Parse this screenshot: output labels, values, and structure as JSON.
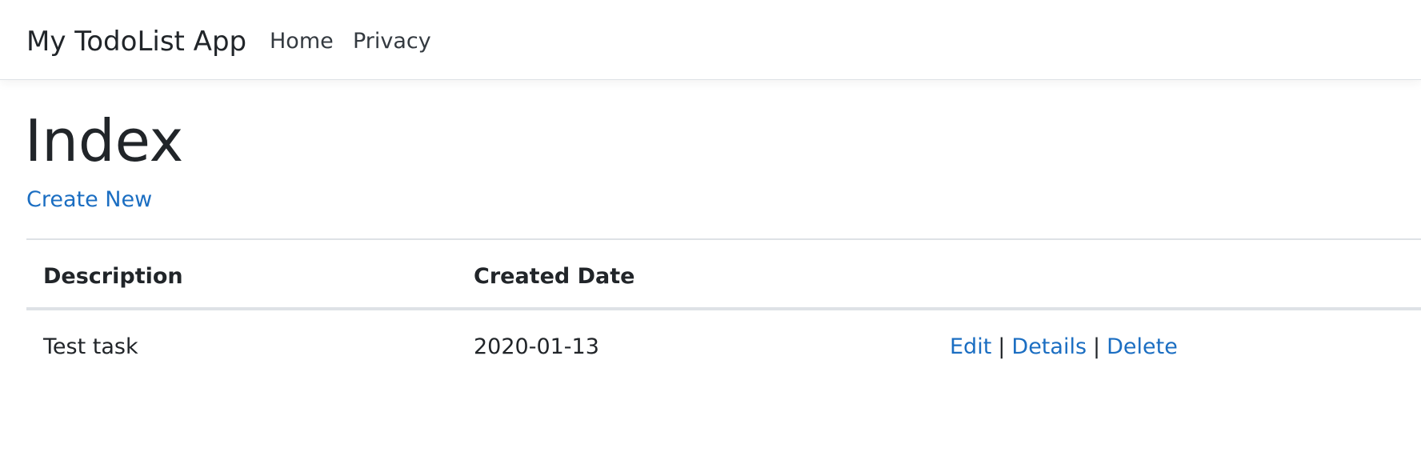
{
  "navbar": {
    "brand": "My TodoList App",
    "links": [
      "Home",
      "Privacy"
    ]
  },
  "main": {
    "title": "Index",
    "create_link": "Create New",
    "table": {
      "columns": [
        "Description",
        "Created Date",
        ""
      ],
      "rows": [
        {
          "description": "Test task",
          "created_date": "2020-01-13",
          "actions": [
            "Edit",
            "Details",
            "Delete"
          ]
        }
      ],
      "separator": "|"
    }
  },
  "colors": {
    "link": "#1b6ec2",
    "text": "#212529",
    "border": "#dee2e6"
  }
}
